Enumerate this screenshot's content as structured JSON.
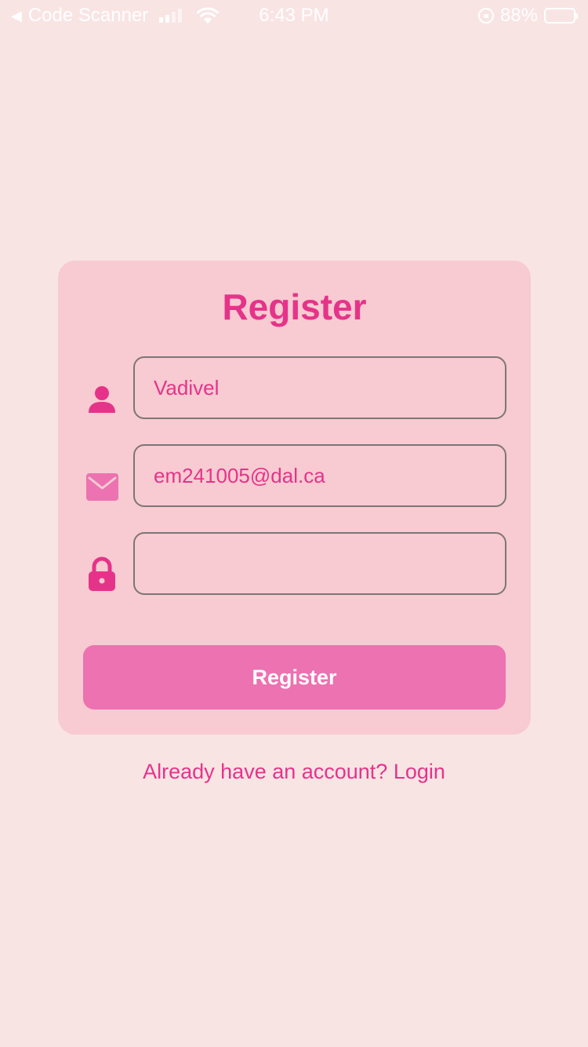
{
  "status_bar": {
    "back_glyph": "◀",
    "app_name": "Code Scanner",
    "time": "6:43 PM",
    "battery_percent": "88%",
    "battery_level": 0.88,
    "signal_icon": "signal-icon",
    "wifi_icon": "wifi-icon",
    "rotation_lock_icon": "rotation-lock-icon",
    "battery_icon": "battery-icon"
  },
  "form": {
    "title": "Register",
    "name_field": {
      "icon": "person-icon",
      "value": "Vadivel",
      "placeholder": ""
    },
    "email_field": {
      "icon": "mail-icon",
      "value": "em241005@dal.ca",
      "placeholder": ""
    },
    "password_field": {
      "icon": "lock-icon",
      "value": "",
      "placeholder": ""
    },
    "submit_label": "Register"
  },
  "footer": {
    "login_prompt": "Already have an account? Login"
  },
  "colors": {
    "background": "#f9e4e4",
    "card": "#f7cbd1",
    "accent": "#e6338a",
    "button": "#ec72b1",
    "input_border": "#7d7677"
  }
}
